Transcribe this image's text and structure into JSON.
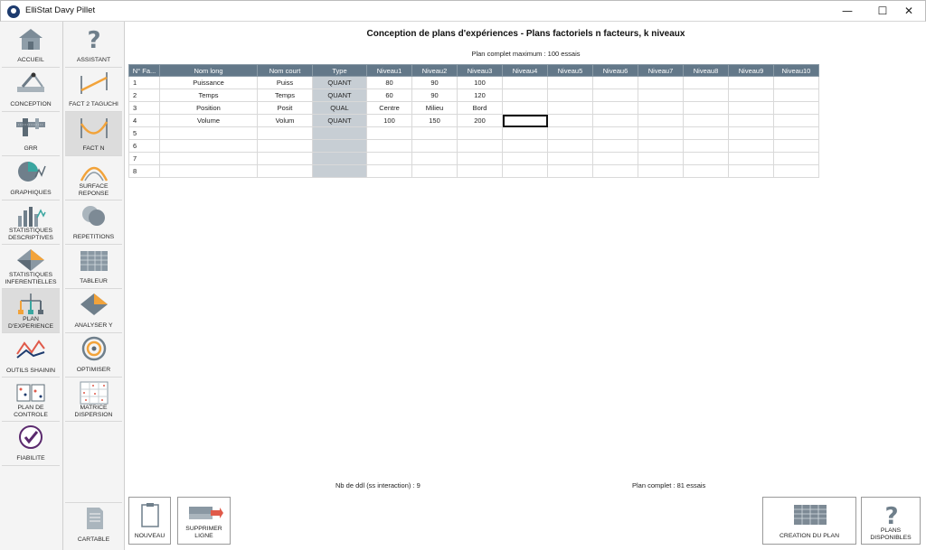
{
  "window": {
    "title": "ElliStat Davy Pillet",
    "minimize": "—",
    "maximize": "☐",
    "close": "✕"
  },
  "sidebar_primary": [
    {
      "label": "ACCUEIL",
      "icon": "house-icon"
    },
    {
      "label": "CONCEPTION",
      "icon": "caliper-icon"
    },
    {
      "label": "GRR",
      "icon": "vernier-icon"
    },
    {
      "label": "GRAPHIQUES",
      "icon": "pie-chart-icon"
    },
    {
      "label": "STATISTIQUES DESCRIPTIVES",
      "icon": "bar-chart-icon"
    },
    {
      "label": "STATISTIQUES INFERENTIELLES",
      "icon": "surface-icon"
    },
    {
      "label": "PLAN D'EXPERIENCE",
      "icon": "tree-icon",
      "active": true
    },
    {
      "label": "OUTILS SHAININ",
      "icon": "shainin-icon"
    },
    {
      "label": "PLAN DE CONTROLE",
      "icon": "control-plan-icon"
    },
    {
      "label": "FIABILITE",
      "icon": "check-icon"
    }
  ],
  "sidebar_secondary": [
    {
      "label": "ASSISTANT",
      "icon": "question-icon"
    },
    {
      "label": "FACT 2 TAGUCHI",
      "icon": "line-icon"
    },
    {
      "label": "FACT N",
      "icon": "curve-icon",
      "active": true
    },
    {
      "label": "SURFACE REPONSE",
      "icon": "arc-icon"
    },
    {
      "label": "REPETITIONS",
      "icon": "cylinders-icon"
    },
    {
      "label": "TABLEUR",
      "icon": "spreadsheet-icon"
    },
    {
      "label": "ANALYSER Y",
      "icon": "analyse-icon"
    },
    {
      "label": "OPTIMISER",
      "icon": "target-icon"
    },
    {
      "label": "MATRICE DISPERSION",
      "icon": "scatter-matrix-icon"
    },
    {
      "label": "CARTABLE",
      "icon": "document-icon"
    }
  ],
  "main": {
    "title": "Conception de plans d'expériences - Plans factoriels n facteurs, k niveaux",
    "plan_max": "Plan complet maximum : 100 essais",
    "ddl": "Nb de ddl (ss interaction) :  9",
    "plan_complet": "Plan complet :  81 essais"
  },
  "table": {
    "headers": [
      "N° Fa...",
      "Nom long",
      "Nom court",
      "Type",
      "Niveau1",
      "Niveau2",
      "Niveau3",
      "Niveau4",
      "Niveau5",
      "Niveau6",
      "Niveau7",
      "Niveau8",
      "Niveau9",
      "Niveau10"
    ],
    "rows": [
      [
        "1",
        "Puissance",
        "Puiss",
        "QUANT",
        "80",
        "90",
        "100",
        "",
        "",
        "",
        "",
        "",
        "",
        ""
      ],
      [
        "2",
        "Temps",
        "Temps",
        "QUANT",
        "60",
        "90",
        "120",
        "",
        "",
        "",
        "",
        "",
        "",
        ""
      ],
      [
        "3",
        "Position",
        "Posit",
        "QUAL",
        "Centre",
        "Milieu",
        "Bord",
        "",
        "",
        "",
        "",
        "",
        "",
        ""
      ],
      [
        "4",
        "Volume",
        "Volum",
        "QUANT",
        "100",
        "150",
        "200",
        "",
        "",
        "",
        "",
        "",
        "",
        ""
      ],
      [
        "5",
        "",
        "",
        "",
        "",
        "",
        "",
        "",
        "",
        "",
        "",
        "",
        "",
        ""
      ],
      [
        "6",
        "",
        "",
        "",
        "",
        "",
        "",
        "",
        "",
        "",
        "",
        "",
        "",
        ""
      ],
      [
        "7",
        "",
        "",
        "",
        "",
        "",
        "",
        "",
        "",
        "",
        "",
        "",
        "",
        ""
      ],
      [
        "8",
        "",
        "",
        "",
        "",
        "",
        "",
        "",
        "",
        "",
        "",
        "",
        "",
        ""
      ]
    ]
  },
  "buttons": {
    "nouveau": "NOUVEAU",
    "supprimer": "SUPPRIMER LIGNE",
    "creation": "CREATION DU PLAN",
    "plans": "PLANS DISPONIBLES"
  },
  "colors": {
    "header": "#637889",
    "type_col": "#c7ced4",
    "active_nav": "#dcdcdc",
    "accent_orange": "#f2a33a",
    "accent_teal": "#3aa6a0"
  }
}
